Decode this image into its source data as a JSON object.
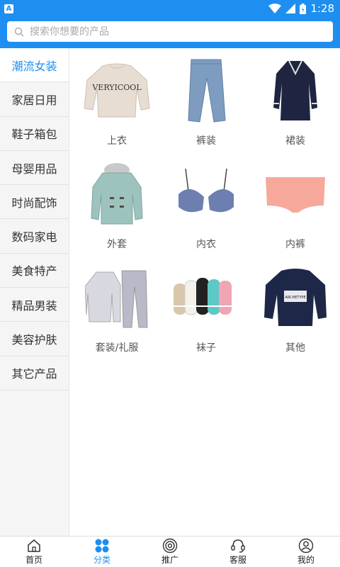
{
  "status": {
    "time": "1:28",
    "notif_icon": "A"
  },
  "search": {
    "placeholder": "搜索你想要的产品"
  },
  "sidebar": {
    "items": [
      {
        "label": "潮流女装",
        "active": true
      },
      {
        "label": "家居日用"
      },
      {
        "label": "鞋子箱包"
      },
      {
        "label": "母婴用品"
      },
      {
        "label": "时尚配饰"
      },
      {
        "label": "数码家电"
      },
      {
        "label": "美食特产"
      },
      {
        "label": "精品男装"
      },
      {
        "label": "美容护肤"
      },
      {
        "label": "其它产品"
      }
    ]
  },
  "products": [
    {
      "label": "上衣",
      "image_text": "VERYICOOL"
    },
    {
      "label": "裤装"
    },
    {
      "label": "裙装"
    },
    {
      "label": "外套"
    },
    {
      "label": "内衣"
    },
    {
      "label": "内裤"
    },
    {
      "label": "套装/礼服"
    },
    {
      "label": "袜子"
    },
    {
      "label": "其他",
      "image_text": "ARCHETYPE"
    }
  ],
  "tabbar": {
    "tabs": [
      {
        "label": "首页",
        "icon": "home-icon"
      },
      {
        "label": "分类",
        "icon": "category-icon",
        "active": true
      },
      {
        "label": "推广",
        "icon": "promote-icon"
      },
      {
        "label": "客服",
        "icon": "headset-icon"
      },
      {
        "label": "我的",
        "icon": "profile-icon"
      }
    ]
  },
  "colors": {
    "accent": "#1e8ff0",
    "sidebar_bg": "#f5f5f5"
  }
}
